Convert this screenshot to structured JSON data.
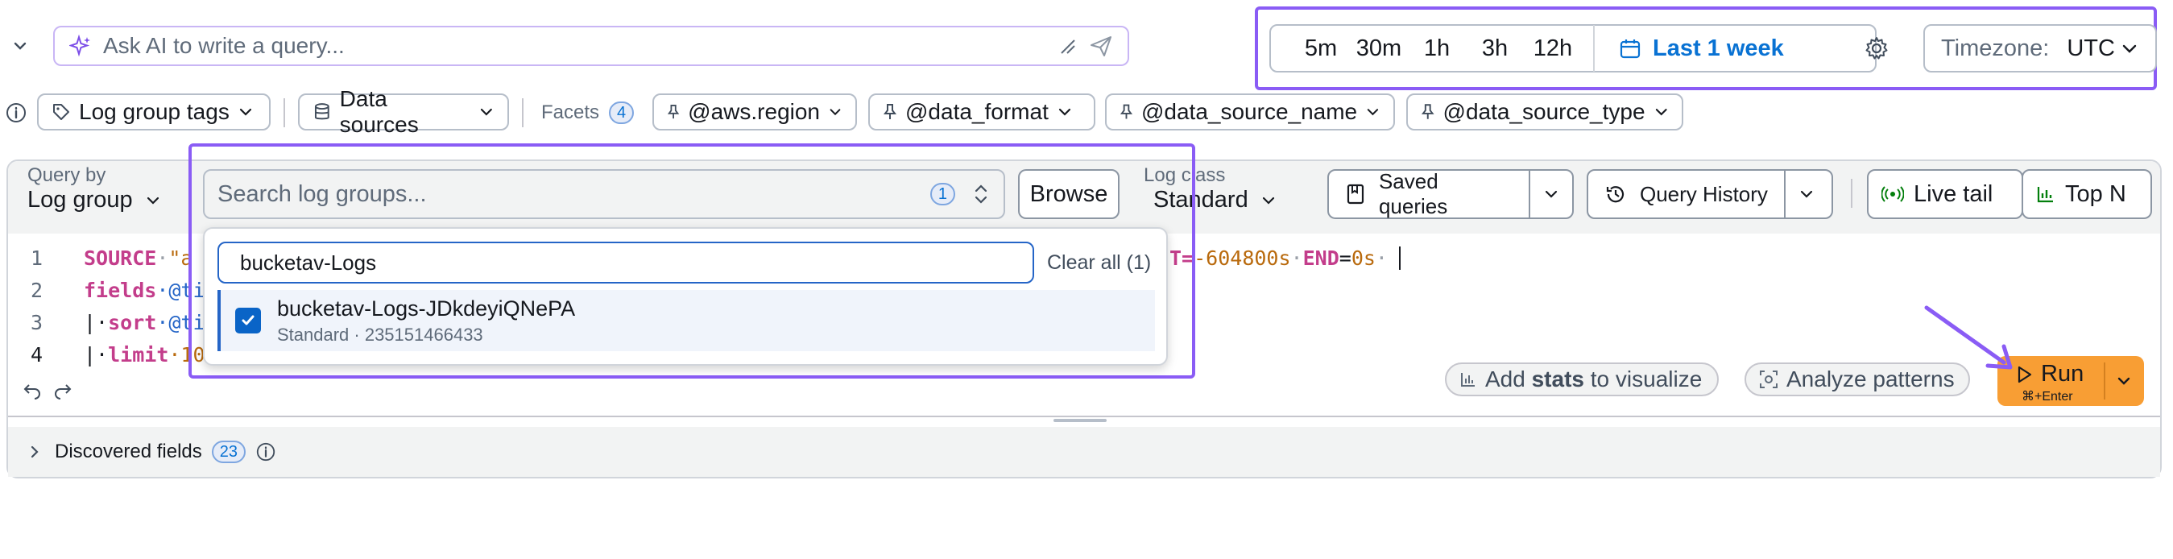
{
  "ai_bar": {
    "placeholder": "Ask AI to write a query..."
  },
  "time_range": {
    "presets": [
      "5m",
      "30m",
      "1h",
      "3h",
      "12h"
    ],
    "selected": "Last 1 week",
    "timezone_label": "Timezone:",
    "timezone_value": "UTC"
  },
  "chips": {
    "log_group_tags": "Log group tags",
    "data_sources": "Data sources",
    "facets_label": "Facets",
    "facets_count": "4",
    "facets": [
      "@aws.region",
      "@data_format",
      "@data_source_name",
      "@data_source_type"
    ]
  },
  "query": {
    "by_label": "Query by",
    "by_value": "Log group",
    "search_placeholder": "Search log groups...",
    "selected_count": "1",
    "browse": "Browse",
    "log_class_label": "Log class",
    "log_class_value": "Standard",
    "saved_queries": "Saved queries",
    "query_history": "Query History",
    "live_tail": "Live tail",
    "top_n": "Top N"
  },
  "editor": {
    "line_numbers": [
      "1",
      "2",
      "3",
      "4"
    ],
    "line1": {
      "kw": "SOURCE",
      "sp": "·",
      "str": "\"a",
      "tail_a": "T=",
      "tail_b": "-604800s",
      "tail_c": "·",
      "end_kw": "END",
      "tail_d": "=",
      "tail_e": "0s",
      "tail_f": "·"
    },
    "line2": {
      "kw": "fields",
      "rest": "·@ti"
    },
    "line3": {
      "pipe": "|·",
      "kw": "sort",
      "rest": "·@ti"
    },
    "line4": {
      "pipe": "|·",
      "kw": "limit",
      "rest": "·10"
    }
  },
  "actions": {
    "add_stats_prefix": "Add ",
    "add_stats_bold": "stats",
    "add_stats_suffix": " to visualize",
    "analyze": "Analyze patterns",
    "run": "Run",
    "run_hint": "⌘+Enter"
  },
  "discovered": {
    "label": "Discovered fields",
    "count": "23"
  },
  "dropdown": {
    "input_value": "bucketav-Logs",
    "clear_all": "Clear all (1)",
    "option_name": "bucketav-Logs-JDkdeyiQNePA",
    "option_meta": "Standard · 235151466433"
  },
  "colors": {
    "accent_purple": "#8a5cf5",
    "run_orange": "#f89e34",
    "link_blue": "#0972d3"
  }
}
